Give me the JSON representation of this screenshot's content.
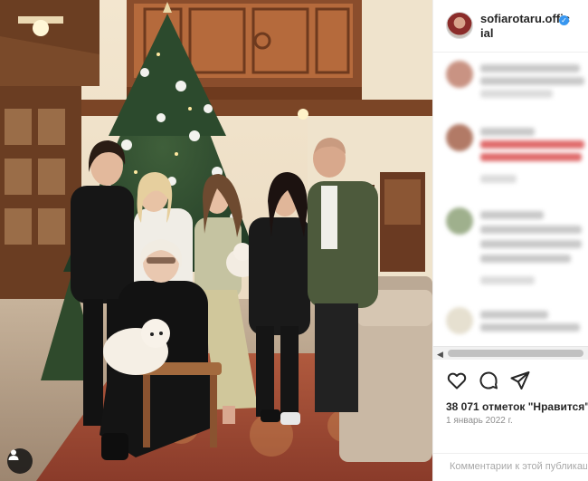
{
  "post": {
    "author": "sofiarotaru.official",
    "verified": true,
    "likes_count": "38 071",
    "likes_label": "отметок \"Нравится\"",
    "date": "1 январь 2022 г.",
    "comment_placeholder": "Комментарии к этой публикации"
  },
  "icons": {
    "like": "heart-icon",
    "comment": "comment-bubble-icon",
    "share": "paper-plane-icon",
    "tag": "person-tag-icon",
    "verified": "check-badge-icon"
  },
  "colors": {
    "verified_blue": "#3897f0",
    "text_primary": "#262626",
    "text_secondary": "#8e8e8e"
  }
}
